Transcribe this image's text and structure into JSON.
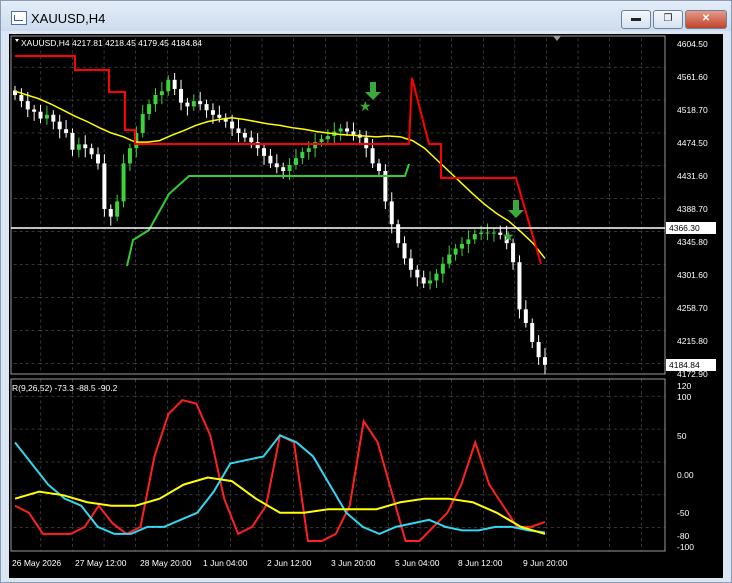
{
  "window": {
    "title": "XAUUSD,H4",
    "min_label": "▬",
    "max_label": "❐",
    "close_label": "✕"
  },
  "main_chart": {
    "info_line": "XAUUSD,H4  4217.81 4218.45 4179.45 4184.84",
    "price_labels": [
      "4604.50",
      "4561.60",
      "4518.70",
      "4474.50",
      "4431.60",
      "4388.70",
      "4345.80",
      "4301.60",
      "4258.70",
      "4215.80",
      "4172.90"
    ],
    "hline_label": "4366.30",
    "current_price_label": "4184.84",
    "colors": {
      "up": "#3cd33c",
      "down": "#ffffff",
      "ma": "#ffff00",
      "red_line": "#ff0000",
      "green_line": "#33cc33",
      "arrow": "#3ca83c"
    }
  },
  "indicator": {
    "label": "R(9,26,52) -73.3 -88.5 -90.2",
    "scale_labels": [
      "120",
      "100",
      "50",
      "0.00",
      "-50",
      "-80",
      "-100"
    ],
    "colors": {
      "line1": "#ff2020",
      "line2": "#33d6f0",
      "line3": "#ffff00"
    }
  },
  "time_labels": [
    "26 May 2026",
    "27 May 12:00",
    "28 May 20:00",
    "1 Jun 04:00",
    "2 Jun 12:00",
    "3 Jun 20:00",
    "5 Jun 04:00",
    "8 Jun 12:00",
    "9 Jun 20:00"
  ],
  "chart_data": {
    "type": "candlestick",
    "symbol": "XAUUSD",
    "timeframe": "H4",
    "ohlc_last": {
      "open": 4217.81,
      "high": 4218.45,
      "low": 4179.45,
      "close": 4184.84
    },
    "horizontal_line": 4366.3,
    "ylim": [
      4172.9,
      4604.5
    ],
    "closes": [
      4540,
      4532,
      4521,
      4518,
      4509,
      4514,
      4505,
      4495,
      4490,
      4468,
      4475,
      4470,
      4462,
      4450,
      4390,
      4380,
      4400,
      4450,
      4470,
      4490,
      4515,
      4528,
      4540,
      4545,
      4560,
      4548,
      4530,
      4525,
      4532,
      4528,
      4520,
      4514,
      4510,
      4505,
      4496,
      4490,
      4484,
      4478,
      4470,
      4460,
      4450,
      4445,
      4440,
      4448,
      4457,
      4465,
      4470,
      4478,
      4482,
      4486,
      4492,
      4496,
      4492,
      4488,
      4484,
      4470,
      4450,
      4440,
      4400,
      4370,
      4345,
      4325,
      4310,
      4300,
      4292,
      4296,
      4305,
      4318,
      4330,
      4338,
      4344,
      4350,
      4357,
      4359,
      4359,
      4359,
      4356,
      4345,
      4320,
      4258,
      4240,
      4215,
      4195,
      4185
    ],
    "ma_line": [
      4545,
      4540,
      4535,
      4528,
      4520,
      4512,
      4505,
      4497,
      4490,
      4485,
      4478,
      4478,
      4480,
      4487,
      4493,
      4500,
      4505,
      4508,
      4510,
      4508,
      4505,
      4502,
      4500,
      4497,
      4495,
      4492,
      4490,
      4488,
      4487,
      4486,
      4485,
      4486,
      4485,
      4480,
      4470,
      4455,
      4440,
      4425,
      4410,
      4396,
      4384,
      4374,
      4360,
      4345,
      4325
    ],
    "indicator_series": [
      {
        "values": [
          -50,
          -60,
          -90,
          -90,
          -90,
          -80,
          -50,
          -75,
          -90,
          -80,
          20,
          80,
          100,
          95,
          50,
          -40,
          -90,
          -80,
          -50,
          50,
          40,
          -100,
          -100,
          -90,
          -50,
          70,
          40,
          -30,
          -100,
          -100,
          -80,
          -60,
          -20,
          40,
          -20,
          -50,
          -80,
          -80,
          -73
        ]
      },
      {
        "values": [
          40,
          10,
          -20,
          -40,
          -50,
          -80,
          -90,
          -90,
          -80,
          -80,
          -70,
          -60,
          -30,
          10,
          15,
          20,
          50,
          40,
          20,
          -20,
          -60,
          -80,
          -90,
          -80,
          -75,
          -70,
          -80,
          -85,
          -85,
          -80,
          -80,
          -85,
          -88
        ]
      },
      {
        "values": [
          -40,
          -30,
          -35,
          -45,
          -50,
          -50,
          -40,
          -20,
          -10,
          -15,
          -40,
          -60,
          -60,
          -55,
          -55,
          -55,
          -45,
          -40,
          -40,
          -45,
          -60,
          -80,
          -90
        ]
      }
    ]
  }
}
